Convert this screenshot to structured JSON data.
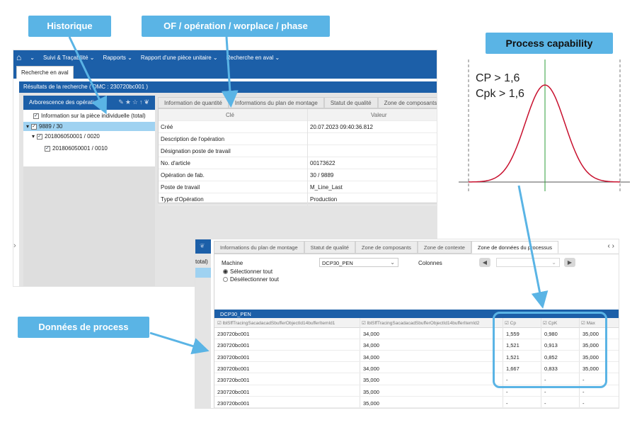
{
  "callouts": {
    "historique": "Historique",
    "of": "OF / opération / worplace / phase",
    "process_capability": "Process capability",
    "donnees": "Données de process"
  },
  "capability": {
    "cp": "CP   > 1,6",
    "cpk": "Cpk > 1,6"
  },
  "nav": {
    "items": [
      "Suivi & Traçabilité ⌄",
      "Rapports ⌄",
      "Rapport d'une pièce unitaire ⌄",
      "Recherche en aval ⌄"
    ],
    "active_tab": "Recherche en aval"
  },
  "results_title": "Résultats de la recherche ( DMC : 230720bc001 )",
  "tree": {
    "header": "Arborescence des opérations",
    "items": [
      "Information sur la pièce individuelle (total)",
      "9889 / 30",
      "201806050001 / 0020",
      "201806050001 / 0010"
    ]
  },
  "detail": {
    "tabs": [
      "Information de quantité",
      "Informations du plan de montage",
      "Statut de qualité",
      "Zone de composants"
    ],
    "header": {
      "key": "Clé",
      "value": "Valeur"
    },
    "rows": [
      {
        "k": "Créé",
        "v": "20.07.2023 09:40:36.812"
      },
      {
        "k": "Description de l'opération",
        "v": ""
      },
      {
        "k": "Désignation poste de travail",
        "v": ""
      },
      {
        "k": "No. d'article",
        "v": "00173622"
      },
      {
        "k": "Opération de fab.",
        "v": "30 / 9889"
      },
      {
        "k": "Poste de travail",
        "v": "M_Line_Last"
      },
      {
        "k": "Type d'Opération",
        "v": "Production"
      }
    ]
  },
  "process": {
    "tabs": [
      "Informations du plan de montage",
      "Statut de qualité",
      "Zone de composants",
      "Zone de contexte",
      "Zone de données du processus"
    ],
    "total_label": "total)",
    "machine_label": "Machine",
    "machine_value": "DCP30_PEN",
    "colonnes_label": "Colonnes",
    "radio_select_all": "Sélectionner tout",
    "radio_deselect_all": "Désélectionner tout",
    "grid_title": "DCP30_PEN",
    "columns": [
      "lblSffTracingSacadacadSbufferObjectId14bufferItemId1",
      "lblSffTracingSacadacadSbufferObjectId14bufferItemId2",
      "Cp",
      "CpK",
      "Max"
    ],
    "rows": [
      [
        "230720bc001",
        "34,000",
        "1,559",
        "0,980",
        "35,000"
      ],
      [
        "230720bc001",
        "34,000",
        "1,521",
        "0,913",
        "35,000"
      ],
      [
        "230720bc001",
        "34,000",
        "1,521",
        "0,852",
        "35,000"
      ],
      [
        "230720bc001",
        "34,000",
        "1,667",
        "0,833",
        "35,000"
      ],
      [
        "230720bc001",
        "35,000",
        "-",
        "-",
        "-"
      ],
      [
        "230720bc001",
        "35,000",
        "-",
        "-",
        "-"
      ],
      [
        "230720bc001",
        "35,000",
        "-",
        "-",
        "-"
      ]
    ]
  },
  "colors": {
    "nav_blue": "#1c5fa8",
    "callout": "#5ab4e5",
    "curve": "#c8102e",
    "center_line": "#2e9e3a",
    "selected": "#9fd2f1"
  }
}
